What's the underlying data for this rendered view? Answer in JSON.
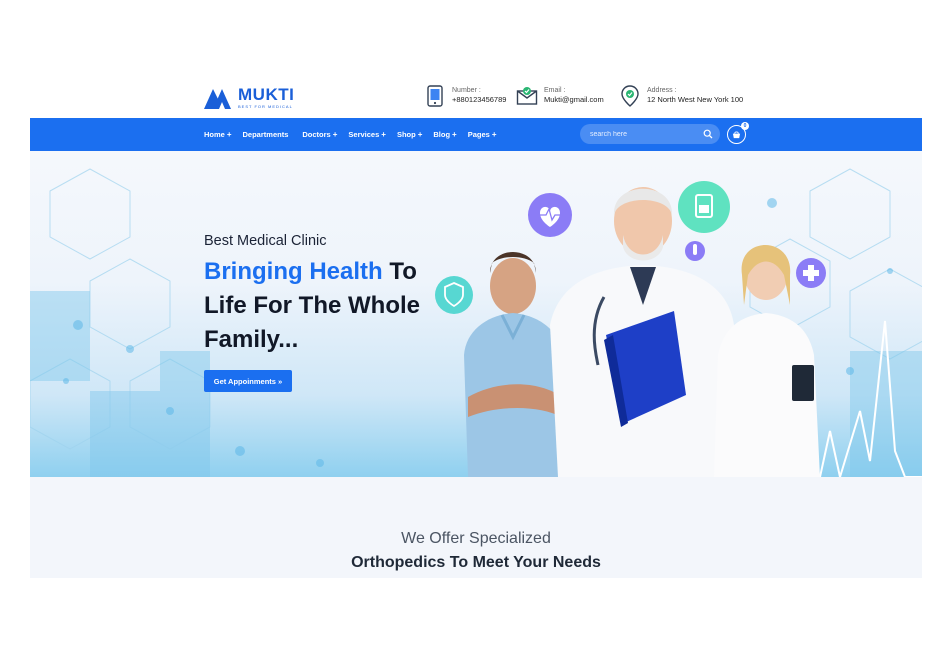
{
  "brand": {
    "name": "MUKTI",
    "tagline": "BEST FOR MEDICAL",
    "color": "#1b6ff0"
  },
  "contacts": [
    {
      "label": "Number :",
      "value": "+880123456789",
      "icon": "phone-icon"
    },
    {
      "label": "Email :",
      "value": "Mukti@gmail.com",
      "icon": "mail-icon"
    },
    {
      "label": "Address :",
      "value": "12 North West New York 100",
      "icon": "location-pin-icon"
    }
  ],
  "nav": {
    "items": [
      {
        "label": "Home",
        "has_submenu": true
      },
      {
        "label": "Departments",
        "has_submenu": false
      },
      {
        "label": "Doctors",
        "has_submenu": true
      },
      {
        "label": "Services",
        "has_submenu": true
      },
      {
        "label": "Shop",
        "has_submenu": true
      },
      {
        "label": "Blog",
        "has_submenu": true
      },
      {
        "label": "Pages",
        "has_submenu": true
      }
    ],
    "plus": "+",
    "search_placeholder": "search here",
    "cart_count": "0"
  },
  "hero": {
    "subtitle": "Best Medical Clinic",
    "title_highlight": "Bringing Health",
    "title_rest": " To Life For The Whole Family...",
    "cta_label": "Get Appoinments »"
  },
  "section": {
    "subtitle": "We Offer Specialized",
    "title": "Orthopedics To Meet Your Needs"
  }
}
